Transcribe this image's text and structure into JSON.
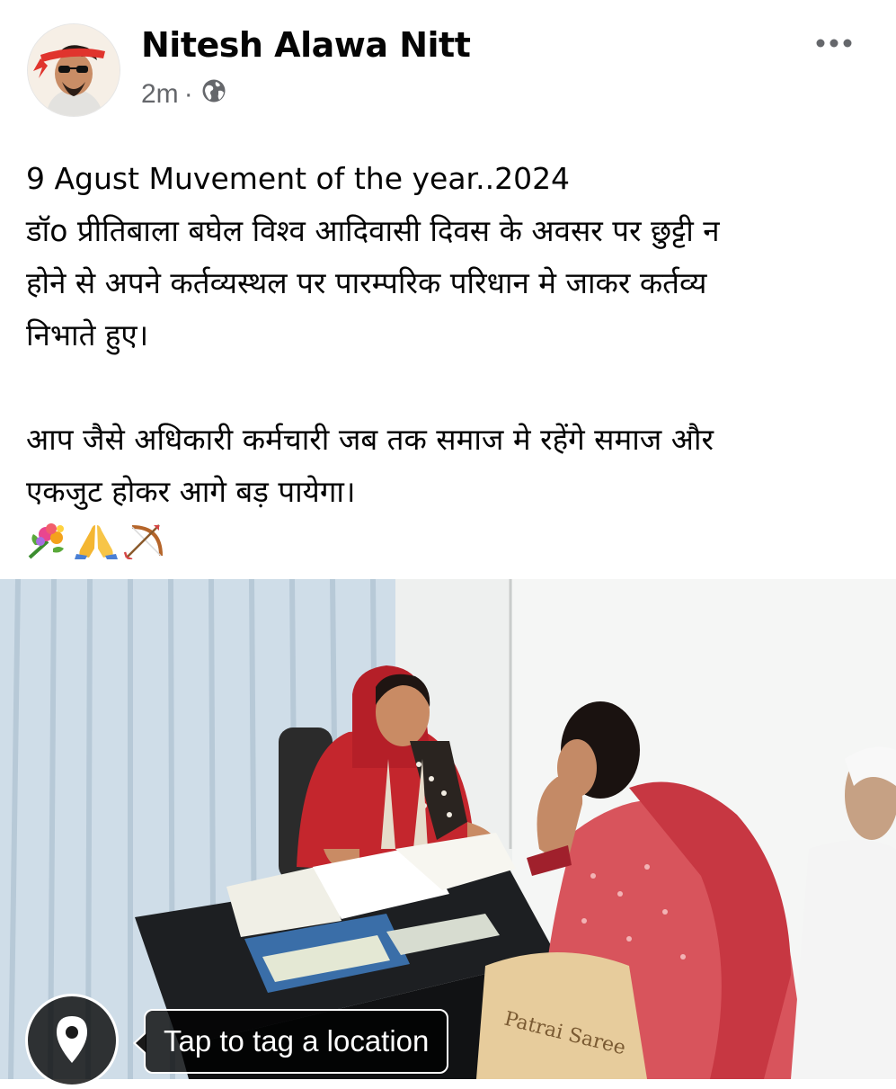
{
  "post": {
    "author": "Nitesh Alawa Nitt",
    "time": "2m",
    "separator": "·",
    "privacy_icon": "globe-icon",
    "more_icon": "ellipsis-icon",
    "text_lines": [
      "9 Agust Muvement of the year..2024",
      "डॉo प्रीतिबाला बघेल विश्व आदिवासी दिवस के अवसर पर छुट्टी न",
      "होने से अपने कर्तव्यस्थल पर पारम्परिक परिधान मे जाकर कर्तव्य",
      "निभाते हुए।",
      "आप जैसे अधिकारी कर्मचारी जब तक समाज मे रहेंगे समाज और",
      "एकजुट होकर आगे बड़ पायेगा।"
    ],
    "emojis": [
      "bouquet-icon",
      "folded-hands-icon",
      "bow-and-arrow-icon"
    ]
  },
  "photo": {
    "bag_text": "Patrai Saree"
  },
  "location": {
    "icon": "location-pin-icon",
    "prompt": "Tap to tag a location"
  },
  "colors": {
    "secondary_text": "#65676b",
    "primary_text": "#050505"
  }
}
